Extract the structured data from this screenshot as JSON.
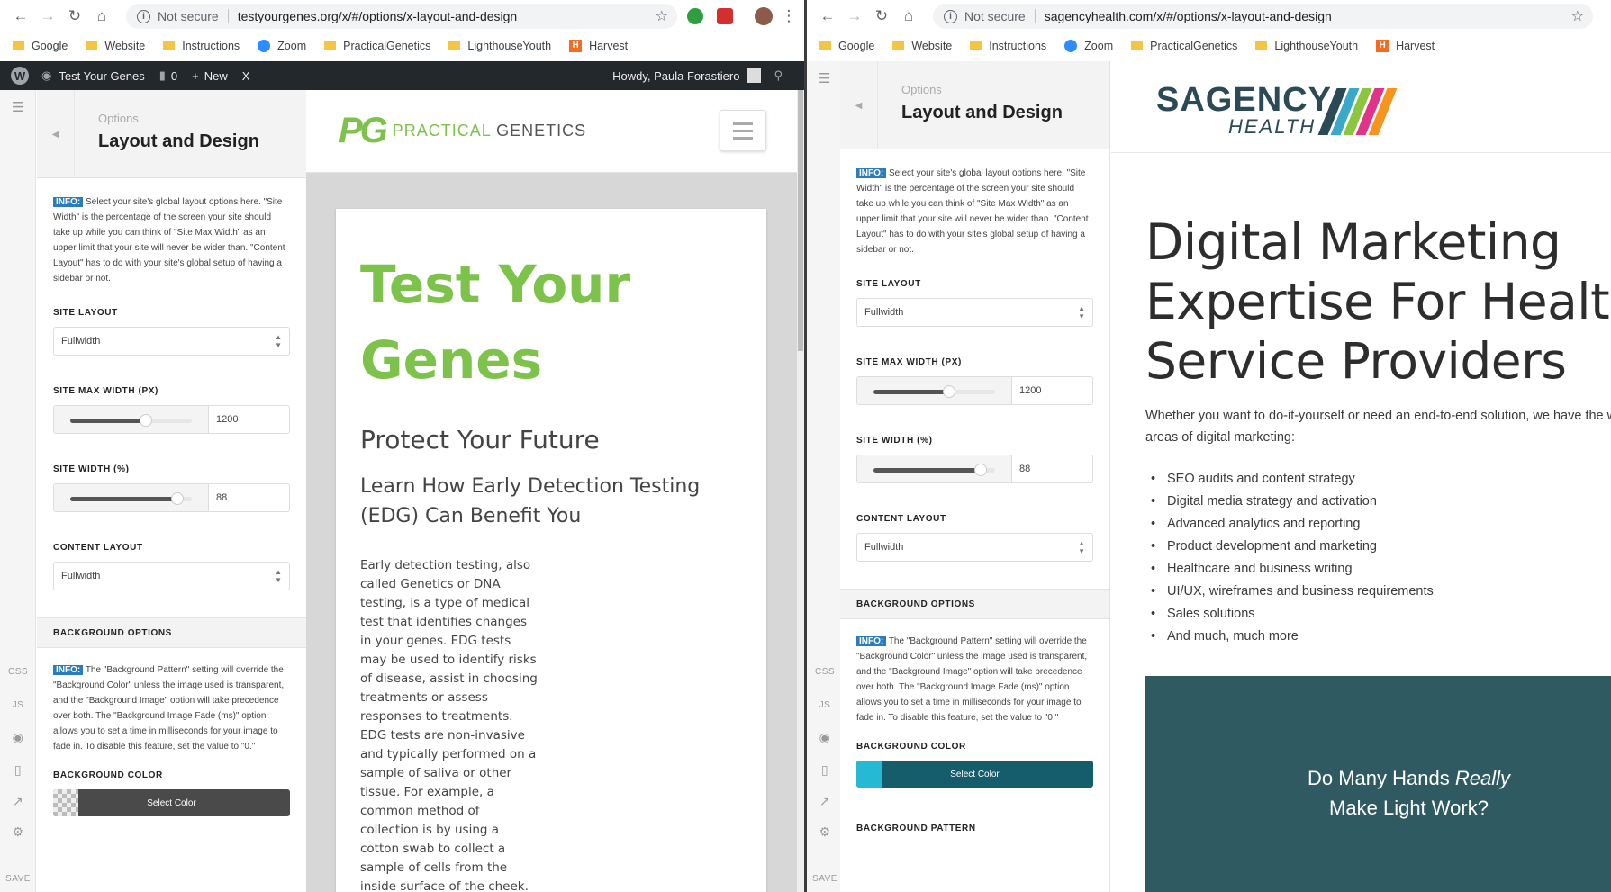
{
  "left_window": {
    "address": {
      "not_secure": "Not secure",
      "url": "testyourgenes.org/x/#/options/x-layout-and-design"
    },
    "bookmarks": [
      "Google",
      "Website",
      "Instructions",
      "Zoom",
      "PracticalGenetics",
      "LighthouseYouth",
      "Harvest"
    ],
    "wp_admin_bar": {
      "site_name": "Test Your Genes",
      "comments": "0",
      "new": "New",
      "x": "X",
      "howdy": "Howdy, Paula Forastiero"
    },
    "customizer": {
      "rail": {
        "css": "CSS",
        "js": "JS",
        "save": "SAVE"
      },
      "breadcrumb": "Options",
      "title": "Layout and Design",
      "info_tag": "INFO:",
      "info_text": " Select your site's global layout options here. \"Site Width\" is the percentage of the screen your site should take up while you can think of \"Site Max Width\" as an upper limit that your site will never be wider than. \"Content Layout\" has to do with your site's global setup of having a sidebar or not.",
      "site_layout_label": "SITE LAYOUT",
      "site_layout_value": "Fullwidth",
      "site_max_width_label": "SITE MAX WIDTH (PX)",
      "site_max_width_value": "1200",
      "site_max_width_slider_percent": 62,
      "site_width_label": "SITE WIDTH (%)",
      "site_width_value": "88",
      "site_width_slider_percent": 88,
      "content_layout_label": "CONTENT LAYOUT",
      "content_layout_value": "Fullwidth",
      "background_options_label": "BACKGROUND OPTIONS",
      "bg_info_text": " The \"Background Pattern\" setting will override the \"Background Color\" unless the image used is transparent, and the \"Background Image\" option will take precedence over both. The \"Background Image Fade (ms)\" option allows you to set a time in milliseconds for your image to fade in. To disable this feature, set the value to \"0.\"",
      "background_color_label": "BACKGROUND COLOR",
      "select_color": "Select Color"
    },
    "site": {
      "logo_text_green": "PRACTICAL",
      "logo_text_gray": "GENETICS",
      "heading": "Test Your Genes",
      "subheading": "Protect Your Future",
      "subheading2": "Learn How Early Detection Testing (EDG) Can Benefit You",
      "body": "Early detection testing, also called Genetics or DNA testing, is a type of medical test that identifies changes in your genes. EDG tests may be used to identify risks of disease, assist in choosing treatments or assess responses to treatments. EDG tests are non-invasive and typically performed on a sample of saliva or other tissue. For example, a common method of collection is by using a cotton swab to collect a sample of cells from the inside surface of the cheek."
    }
  },
  "right_window": {
    "address": {
      "not_secure": "Not secure",
      "url": "sagencyhealth.com/x/#/options/x-layout-and-design"
    },
    "bookmarks": [
      "Google",
      "Website",
      "Instructions",
      "Zoom",
      "PracticalGenetics",
      "LighthouseYouth",
      "Harvest"
    ],
    "customizer": {
      "rail": {
        "css": "CSS",
        "js": "JS",
        "save": "SAVE"
      },
      "breadcrumb": "Options",
      "title": "Layout and Design",
      "info_tag": "INFO:",
      "info_text": " Select your site's global layout options here. \"Site Width\" is the percentage of the screen your site should take up while you can think of \"Site Max Width\" as an upper limit that your site will never be wider than. \"Content Layout\" has to do with your site's global setup of having a sidebar or not.",
      "site_layout_label": "SITE LAYOUT",
      "site_layout_value": "Fullwidth",
      "site_max_width_label": "SITE MAX WIDTH (PX)",
      "site_max_width_value": "1200",
      "site_max_width_slider_percent": 62,
      "site_width_label": "SITE WIDTH (%)",
      "site_width_value": "88",
      "site_width_slider_percent": 88,
      "content_layout_label": "CONTENT LAYOUT",
      "content_layout_value": "Fullwidth",
      "background_options_label": "BACKGROUND OPTIONS",
      "bg_info_text": " The \"Background Pattern\" setting will override the \"Background Color\" unless the image used is transparent, and the \"Background Image\" option will take precedence over both. The \"Background Image Fade (ms)\" option allows you to set a time in milliseconds for your image to fade in. To disable this feature, set the value to \"0.\"",
      "background_color_label": "BACKGROUND COLOR",
      "select_color": "Select Color",
      "background_pattern_label": "BACKGROUND PATTERN"
    },
    "site": {
      "logo_word": "SAGENCY",
      "logo_sub": "HEALTH",
      "heading": "Digital Marketing Expertise For Health Service Providers",
      "intro": "Whether you want to do-it-yourself or need an end-to-end solution, we have the with all areas of digital marketing:",
      "services": [
        "SEO audits and content strategy",
        "Digital media strategy and activation",
        "Advanced analytics and reporting",
        "Product development and marketing",
        "Healthcare and business writing",
        "UI/UX, wireframes and business requirements",
        "Sales solutions",
        "And much, much more"
      ],
      "box_line1": "Do Many Hands ",
      "box_emph": "Really",
      "box_line2": "Make Light Work?"
    }
  },
  "colors": {
    "pg_green": "#7dc24b",
    "sagency_navy": "#2c4a56",
    "sagency_box": "#2f5a62",
    "bg_color_right": "#155d6b",
    "bg_color_right_swatch": "#26b9d4",
    "wp_bar": "#23282d"
  }
}
